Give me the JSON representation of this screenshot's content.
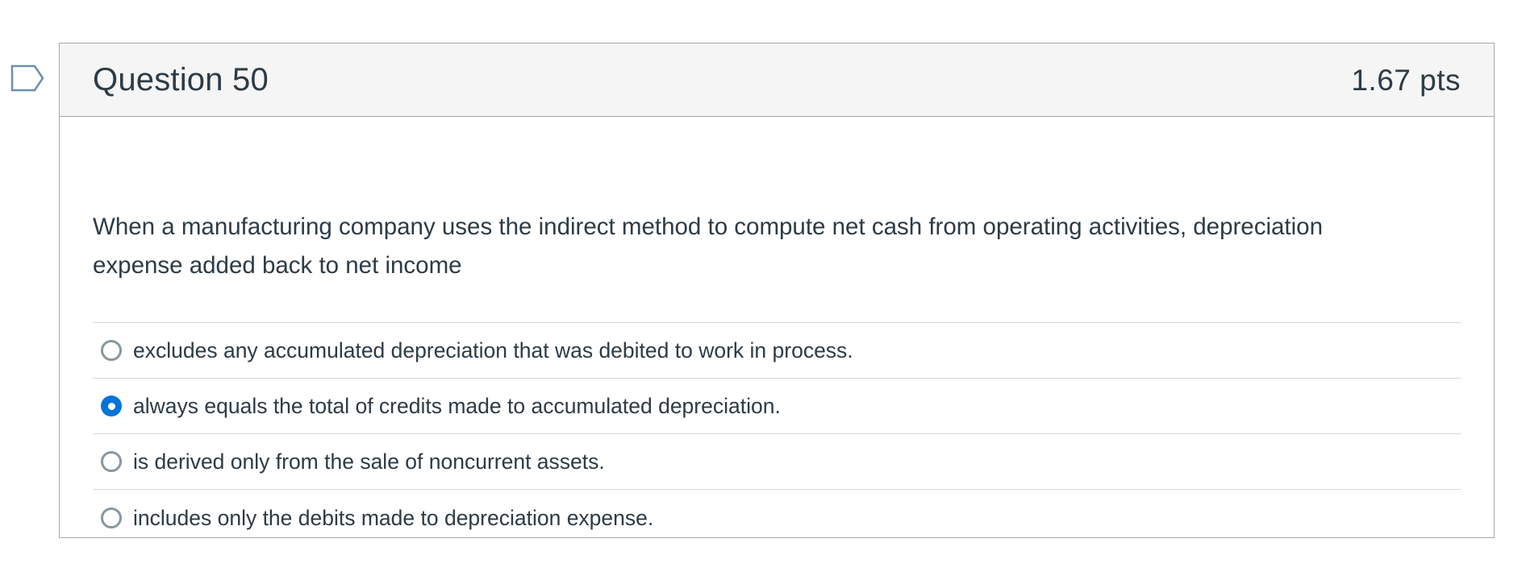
{
  "question": {
    "title": "Question 50",
    "points": "1.67 pts",
    "text_lines": [
      "When a manufacturing company uses the indirect method to compute net cash from operating activities, depreciation",
      "expense added back to net income"
    ],
    "answers": [
      {
        "label": "excludes any accumulated depreciation that was debited to work in process.",
        "selected": false
      },
      {
        "label": "always equals the total of credits made to accumulated depreciation.",
        "selected": true
      },
      {
        "label": "is derived only from the sale of noncurrent assets.",
        "selected": false
      },
      {
        "label": "includes only the debits made to depreciation expense.",
        "selected": false
      }
    ]
  },
  "colors": {
    "accent": "#0374d8",
    "header_bg": "#f5f5f5",
    "text": "#2d3b45",
    "border": "#a9a9a9",
    "flag": "#6b8fae"
  },
  "icons": {
    "flag": "bookmark-flag-icon"
  }
}
